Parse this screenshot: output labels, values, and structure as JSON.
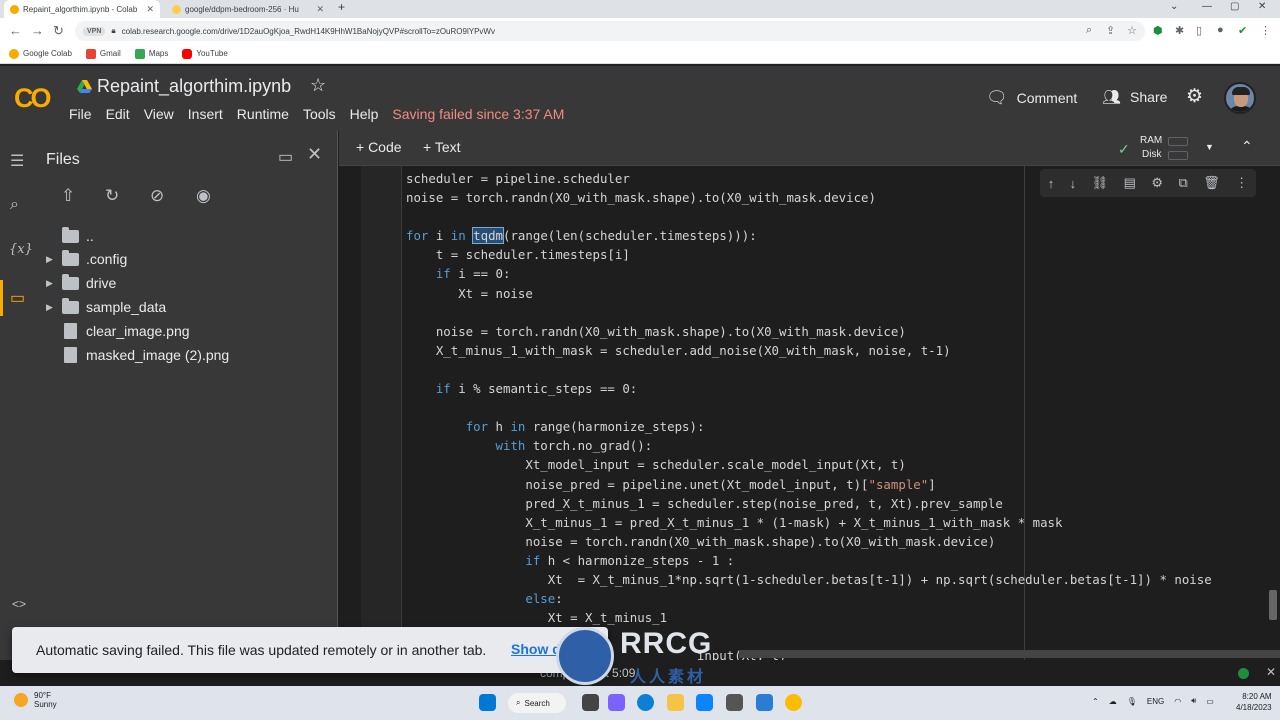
{
  "browser": {
    "tabs": [
      {
        "title": "Repaint_algorthim.ipynb - Colab",
        "active": true
      },
      {
        "title": "google/ddpm-bedroom-256 · Hu",
        "active": false
      }
    ],
    "vpn_label": "VPN",
    "url": "colab.research.google.com/drive/1D2auOgKjoa_RwdH14K9HhW1BaNojyQVP#scrollTo=zOuRO9lYPvWv",
    "bookmarks": [
      {
        "label": "Google Colab",
        "color": "#f9ab00"
      },
      {
        "label": "Gmail",
        "color": "#ea4335"
      },
      {
        "label": "Maps",
        "color": "#34a853"
      },
      {
        "label": "YouTube",
        "color": "#ff0000"
      }
    ]
  },
  "colab": {
    "logo": "CO",
    "notebook_title": "Repaint_algorthim.ipynb",
    "menu": [
      "File",
      "Edit",
      "View",
      "Insert",
      "Runtime",
      "Tools",
      "Help"
    ],
    "save_status": "Saving failed since 3:37 AM",
    "comment_label": "Comment",
    "share_label": "Share"
  },
  "files_panel": {
    "title": "Files",
    "items": [
      {
        "name": "..",
        "type": "up"
      },
      {
        "name": ".config",
        "type": "folder"
      },
      {
        "name": "drive",
        "type": "folder"
      },
      {
        "name": "sample_data",
        "type": "folder"
      },
      {
        "name": "clear_image.png",
        "type": "file"
      },
      {
        "name": "masked_image (2).png",
        "type": "file"
      }
    ]
  },
  "notebook_toolbar": {
    "add_code": "+ Code",
    "add_text": "+ Text",
    "ram_label": "RAM",
    "disk_label": "Disk"
  },
  "code_lines": [
    "scheduler = pipeline.scheduler",
    "noise = torch.randn(X0_with_mask.shape).to(X0_with_mask.device)",
    "",
    "for i in tqdm(range(len(scheduler.timesteps))):",
    "    t = scheduler.timesteps[i]",
    "    if i == 0:",
    "       Xt = noise",
    "",
    "    noise = torch.randn(X0_with_mask.shape).to(X0_with_mask.device)",
    "    X_t_minus_1_with_mask = scheduler.add_noise(X0_with_mask, noise, t-1)",
    "",
    "    if i % semantic_steps == 0:",
    "",
    "        for h in range(harmonize_steps):",
    "            with torch.no_grad():",
    "                Xt_model_input = scheduler.scale_model_input(Xt, t)",
    "                noise_pred = pipeline.unet(Xt_model_input, t)[\"sample\"]",
    "                pred_X_t_minus_1 = scheduler.step(noise_pred, t, Xt).prev_sample",
    "                X_t_minus_1 = pred_X_t_minus_1 * (1-mask) + X_t_minus_1_with_mask * mask",
    "                noise = torch.randn(X0_with_mask.shape).to(X0_with_mask.device)",
    "                if h < harmonize_steps - 1 :",
    "                   Xt  = X_t_minus_1*np.sqrt(1-scheduler.betas[t-1]) + np.sqrt(scheduler.betas[t-1]) * noise",
    "                else:",
    "                   Xt = X_t_minus_1",
    "        el",
    "                                       input(Xt, t)"
  ],
  "highlighted_word": "tqdm",
  "snackbar": {
    "message": "Automatic saving failed. This file was updated remotely or in another tab.",
    "action": "Show d"
  },
  "statusbar": {
    "executing_text": "completed at 5:09"
  },
  "watermark": {
    "text": "RRCG",
    "sub": "人人素材"
  },
  "taskbar": {
    "temperature": "90°F",
    "condition": "Sunny",
    "search_label": "Search",
    "language": "ENG",
    "time": "8:20 AM",
    "date": "4/18/2023"
  }
}
